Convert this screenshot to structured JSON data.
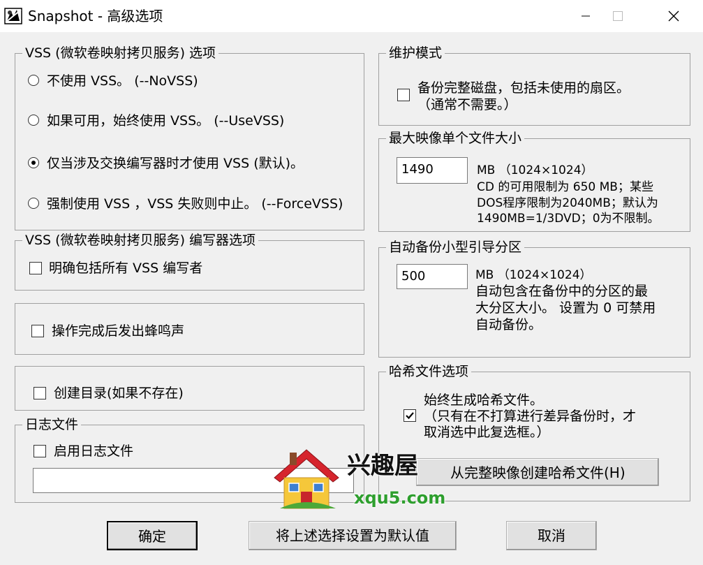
{
  "window": {
    "title": "Snapshot - 高级选项"
  },
  "vss_options": {
    "legend": "VSS (微软卷映射拷贝服务) 选项",
    "radios": [
      {
        "label": "不使用 VSS。 (--NoVSS)",
        "selected": false
      },
      {
        "label": "如果可用，始终使用 VSS。 (--UseVSS)",
        "selected": false
      },
      {
        "label": "仅当涉及交换编写器时才使用 VSS (默认)。",
        "selected": true
      },
      {
        "label": "强制使用 VSS ，VSS 失败则中止。 (--ForceVSS)",
        "selected": false
      }
    ]
  },
  "vss_writer": {
    "legend": "VSS (微软卷映射拷贝服务) 编写器选项",
    "include_all_label": "明确包括所有 VSS 编写者",
    "include_all_checked": false
  },
  "beep": {
    "label": "操作完成后发出蜂鸣声",
    "checked": false
  },
  "create_dir": {
    "label": "创建目录(如果不存在)",
    "checked": false
  },
  "log": {
    "legend": "日志文件",
    "enable_label": "启用日志文件",
    "enable_checked": false,
    "path_value": ""
  },
  "maintenance": {
    "legend": "维护模式",
    "backup_full_label": "备份完整磁盘，包括未使用的扇区。",
    "backup_full_note": "（通常不需要。）",
    "checked": false
  },
  "max_image": {
    "legend": "最大映像单个文件大小",
    "value": "1490",
    "unit": "MB （1024×1024）",
    "desc": [
      "CD 的可用限制为 650 MB；某些",
      "DOS程序限制为2040MB；默认为",
      "1490MB=1/3DVD；0为不限制。"
    ]
  },
  "auto_boot": {
    "legend": "自动备份小型引导分区",
    "value": "500",
    "unit": "MB （1024×1024）",
    "desc": [
      "自动包含在备份中的分区的最",
      "大分区大小。 设置为 0 可禁用",
      "自动备份。"
    ]
  },
  "hash": {
    "legend": "哈希文件选项",
    "always_label": "始终生成哈希文件。",
    "note": [
      "（只有在不打算进行差异备份时，才",
      "取消选中此复选框。）"
    ],
    "checked": true,
    "create_button": "从完整映像创建哈希文件(H)"
  },
  "buttons": {
    "ok": "确定",
    "set_default": "将上述选择设置为默认值",
    "cancel": "取消"
  },
  "watermark": {
    "brand": "兴趣屋",
    "site": "xqu5.com"
  }
}
